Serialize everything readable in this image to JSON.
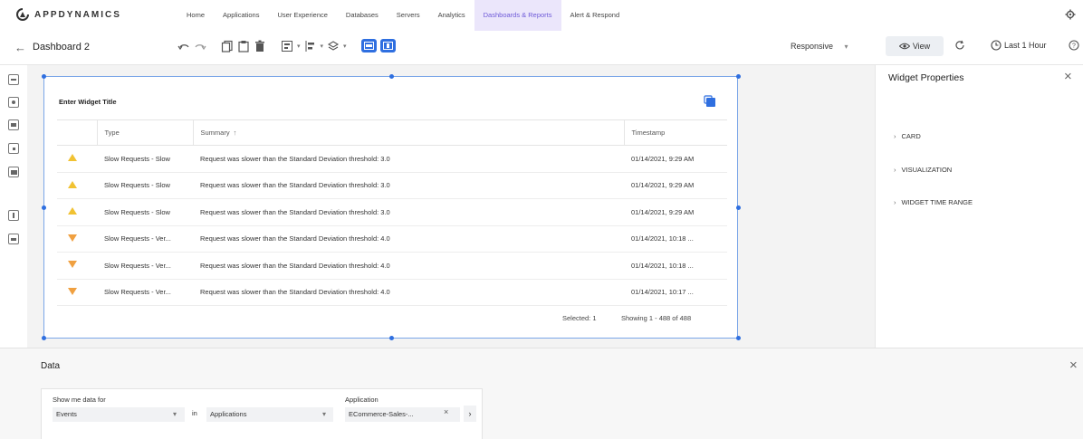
{
  "brand": {
    "name": "APPDYNAMICS",
    "accent": "#6e5ad8",
    "primary_blue": "#2f6fe0"
  },
  "nav": {
    "tabs": [
      {
        "label": "Home"
      },
      {
        "label": "Applications"
      },
      {
        "label": "User Experience"
      },
      {
        "label": "Databases"
      },
      {
        "label": "Servers"
      },
      {
        "label": "Analytics"
      },
      {
        "label": "Dashboards & Reports",
        "active": true
      },
      {
        "label": "Alert & Respond"
      }
    ]
  },
  "toolbar": {
    "dashboard_title": "Dashboard 2",
    "icons": [
      "undo-icon",
      "redo-icon",
      "copy-icon",
      "paste-icon",
      "delete-icon",
      "align-icon",
      "distribute-icon",
      "layer-icon",
      "layout-1-icon",
      "layout-2-icon"
    ],
    "responsive_label": "Responsive",
    "view_label": "View",
    "time_range_label": "Last 1 Hour"
  },
  "widget": {
    "title": "Enter Widget Title",
    "columns": [
      "Type",
      "Summary",
      "Timestamp"
    ],
    "rows": [
      {
        "severity": "warning",
        "type": "Slow Requests - Slow",
        "summary": "Request was slower than the Standard Deviation threshold: 3.0",
        "timestamp": "01/14/2021, 9:29 AM"
      },
      {
        "severity": "warning",
        "type": "Slow Requests - Slow",
        "summary": "Request was slower than the Standard Deviation threshold: 3.0",
        "timestamp": "01/14/2021, 9:29 AM"
      },
      {
        "severity": "warning",
        "type": "Slow Requests - Slow",
        "summary": "Request was slower than the Standard Deviation threshold: 3.0",
        "timestamp": "01/14/2021, 9:29 AM"
      },
      {
        "severity": "critical",
        "type": "Slow Requests - Ver...",
        "summary": "Request was slower than the Standard Deviation threshold: 4.0",
        "timestamp": "01/14/2021, 10:18 ..."
      },
      {
        "severity": "critical",
        "type": "Slow Requests - Ver...",
        "summary": "Request was slower than the Standard Deviation threshold: 4.0",
        "timestamp": "01/14/2021, 10:18 ..."
      },
      {
        "severity": "critical",
        "type": "Slow Requests - Ver...",
        "summary": "Request was slower than the Standard Deviation threshold: 4.0",
        "timestamp": "01/14/2021, 10:17 ..."
      }
    ],
    "selected_text": "Selected: 1",
    "showing_text": "Showing 1 - 488 of 488"
  },
  "properties": {
    "title": "Widget Properties",
    "sections": [
      "CARD",
      "VISUALIZATION",
      "WIDGET TIME RANGE"
    ]
  },
  "data_panel": {
    "title": "Data",
    "show_me_label": "Show me data for",
    "show_me_value": "Events",
    "in_label": "in",
    "in_value": "Applications",
    "application_label": "Application",
    "application_value": "ECommerce-Sales-..."
  }
}
